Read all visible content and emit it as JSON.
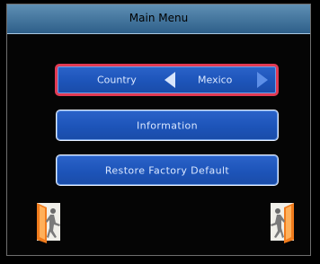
{
  "header": {
    "title": "Main Menu"
  },
  "menu": {
    "country": {
      "label": "Country",
      "value": "Mexico",
      "left_icon": "triangle-left",
      "right_icon": "triangle-right"
    },
    "information": {
      "label": "Information"
    },
    "restore": {
      "label": "Restore Factory Default"
    }
  },
  "footer": {
    "left_icon": "exit-door-icon",
    "right_icon": "exit-door-icon"
  },
  "colors": {
    "selected_border": "#e23b54",
    "button_blue": "#1f58bf",
    "title_bar": "#3e6f98"
  }
}
